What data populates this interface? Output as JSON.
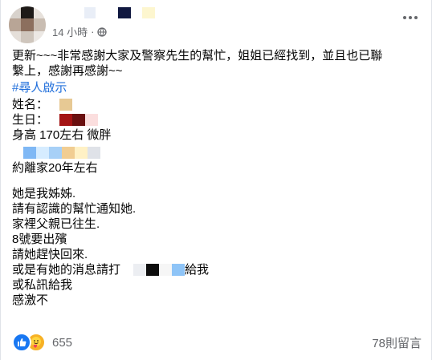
{
  "header": {
    "timestamp": "14 小時",
    "separator": "·",
    "visibility_icon": "globe-icon",
    "more_icon": "more-options-icon"
  },
  "post": {
    "lines": [
      "更新~~~非常感謝大家及警察先生的幫忙，姐姐已經找到，並且也已聯",
      "繫上，感謝再感謝~~",
      "#尋人啟示",
      "姓名：",
      "生日：",
      "身高 170左右 微胖",
      "",
      "約離家20年左右",
      "她是我姊姊.",
      "請有認識的幫忙通知她.",
      "家裡父親已往生.",
      "8號要出殯",
      "請她趕快回來.",
      "或是有她的消息請打",
      "給我",
      "或私訊給我",
      "感激不"
    ]
  },
  "footer": {
    "reaction_count": "655",
    "comments_label": "78則留言",
    "reaction_icons": [
      "like-icon",
      "care-icon"
    ]
  },
  "colors": {
    "hashtag": "#216fdb",
    "meta": "#65676b",
    "like": "#1877f2",
    "care": "#f7b125"
  }
}
